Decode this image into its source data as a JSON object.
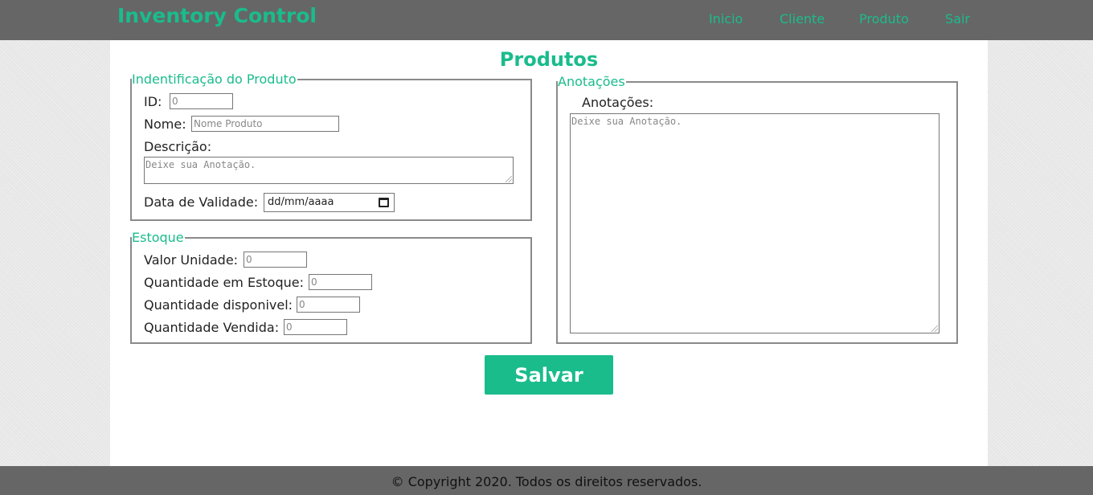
{
  "brand": "Inventory Control",
  "nav": [
    "Inicio",
    "Cliente",
    "Produto",
    "Sair"
  ],
  "page_title": "Produtos",
  "identificacao": {
    "legend": "Indentificação do Produto",
    "id_label": "ID:",
    "id_placeholder": "0",
    "nome_label": "Nome:",
    "nome_placeholder": "Nome Produto",
    "descricao_label": "Descrição:",
    "descricao_placeholder": "Deixe sua Anotação.",
    "validade_label": "Data de Validade:",
    "validade_placeholder": "dd/mm/aaaa"
  },
  "estoque": {
    "legend": "Estoque",
    "valor_label": "Valor Unidade:",
    "valor_placeholder": "0",
    "qtd_estoque_label": "Quantidade em Estoque:",
    "qtd_estoque_placeholder": "0",
    "qtd_disponivel_label": "Quantidade disponivel:",
    "qtd_disponivel_placeholder": "0",
    "qtd_vendida_label": "Quantidade Vendida:",
    "qtd_vendida_placeholder": "0"
  },
  "anotacoes": {
    "legend": "Anotações",
    "label": "Anotações:",
    "placeholder": "Deixe sua Anotação."
  },
  "save_label": "Salvar",
  "footer": "© Copyright 2020. Todos os direitos reservados.",
  "colors": {
    "accent": "#1abc8c",
    "header_bg": "#666666"
  }
}
